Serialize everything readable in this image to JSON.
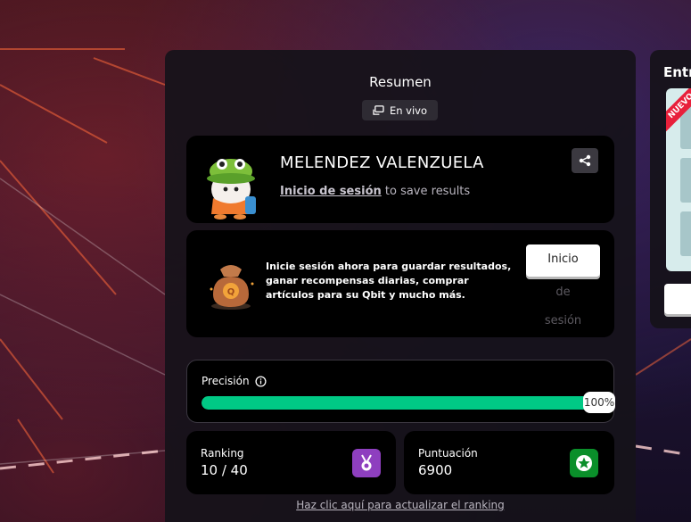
{
  "summary": {
    "title": "Resumen",
    "live_badge": "En vivo"
  },
  "profile": {
    "name": "MELENDEZ VALENZUELA",
    "login_link": "Inicio de sesión",
    "login_suffix": " to save results"
  },
  "promo": {
    "text": "Inicie sesión ahora para guardar resultados, ganar recompensas diarias, comprar artículos para su Qbit y mucho más.",
    "button_label": "Inicio",
    "button_overflow": [
      "de",
      "sesión"
    ]
  },
  "accuracy": {
    "label": "Precisión",
    "value_label": "100%",
    "fill_percent": 100
  },
  "ranking": {
    "label": "Ranking",
    "value": "10 / 40"
  },
  "score": {
    "label": "Puntuación",
    "value": "6900"
  },
  "refresh_link": "Haz clic aquí para actualizar el ranking",
  "side": {
    "title": "Entr",
    "ribbon": "NUEVO"
  },
  "colors": {
    "accent_green": "#00c985",
    "ranking_icon_bg": "#8e3fbf",
    "score_icon_bg": "#0a8f2a",
    "ribbon_red": "#e8203b"
  },
  "icons": {
    "live": "screen-cast-icon",
    "share": "share-icon",
    "info": "info-icon",
    "ranking": "medal-icon",
    "score": "star-icon"
  }
}
